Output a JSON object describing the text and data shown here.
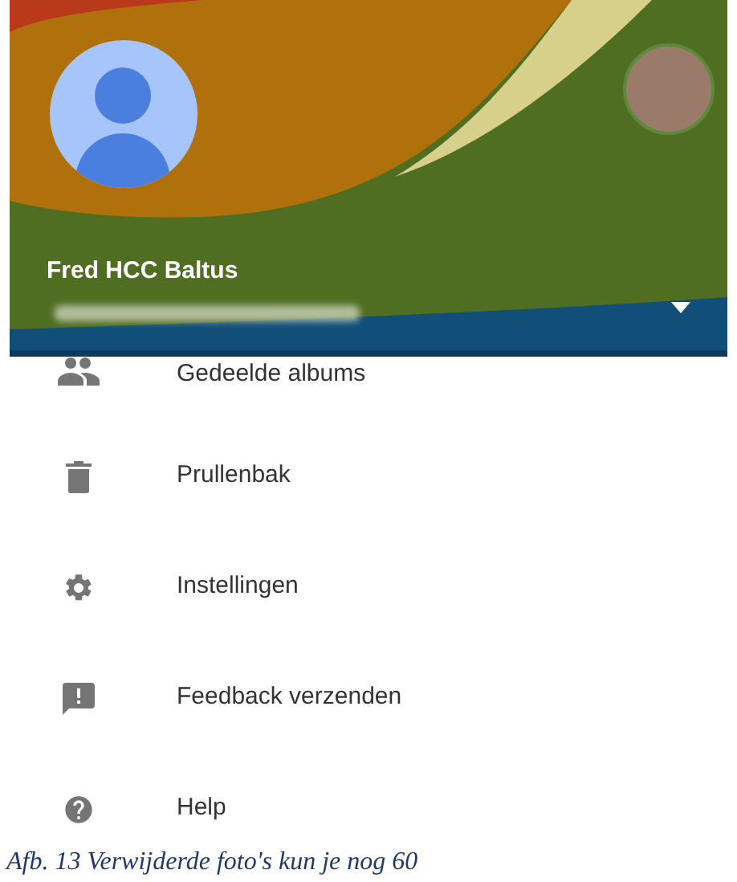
{
  "header": {
    "name": "Fred HCC Baltus"
  },
  "menu": [
    {
      "kind": "people",
      "label": "Gedeelde albums"
    },
    {
      "kind": "trash",
      "label": "Prullenbak"
    },
    {
      "kind": "settings",
      "label": "Instellingen"
    },
    {
      "kind": "feedback",
      "label": "Feedback verzenden"
    },
    {
      "kind": "help",
      "label": "Help"
    }
  ],
  "caption": "Afb. 13 Verwijderde foto's kun je nog 60"
}
